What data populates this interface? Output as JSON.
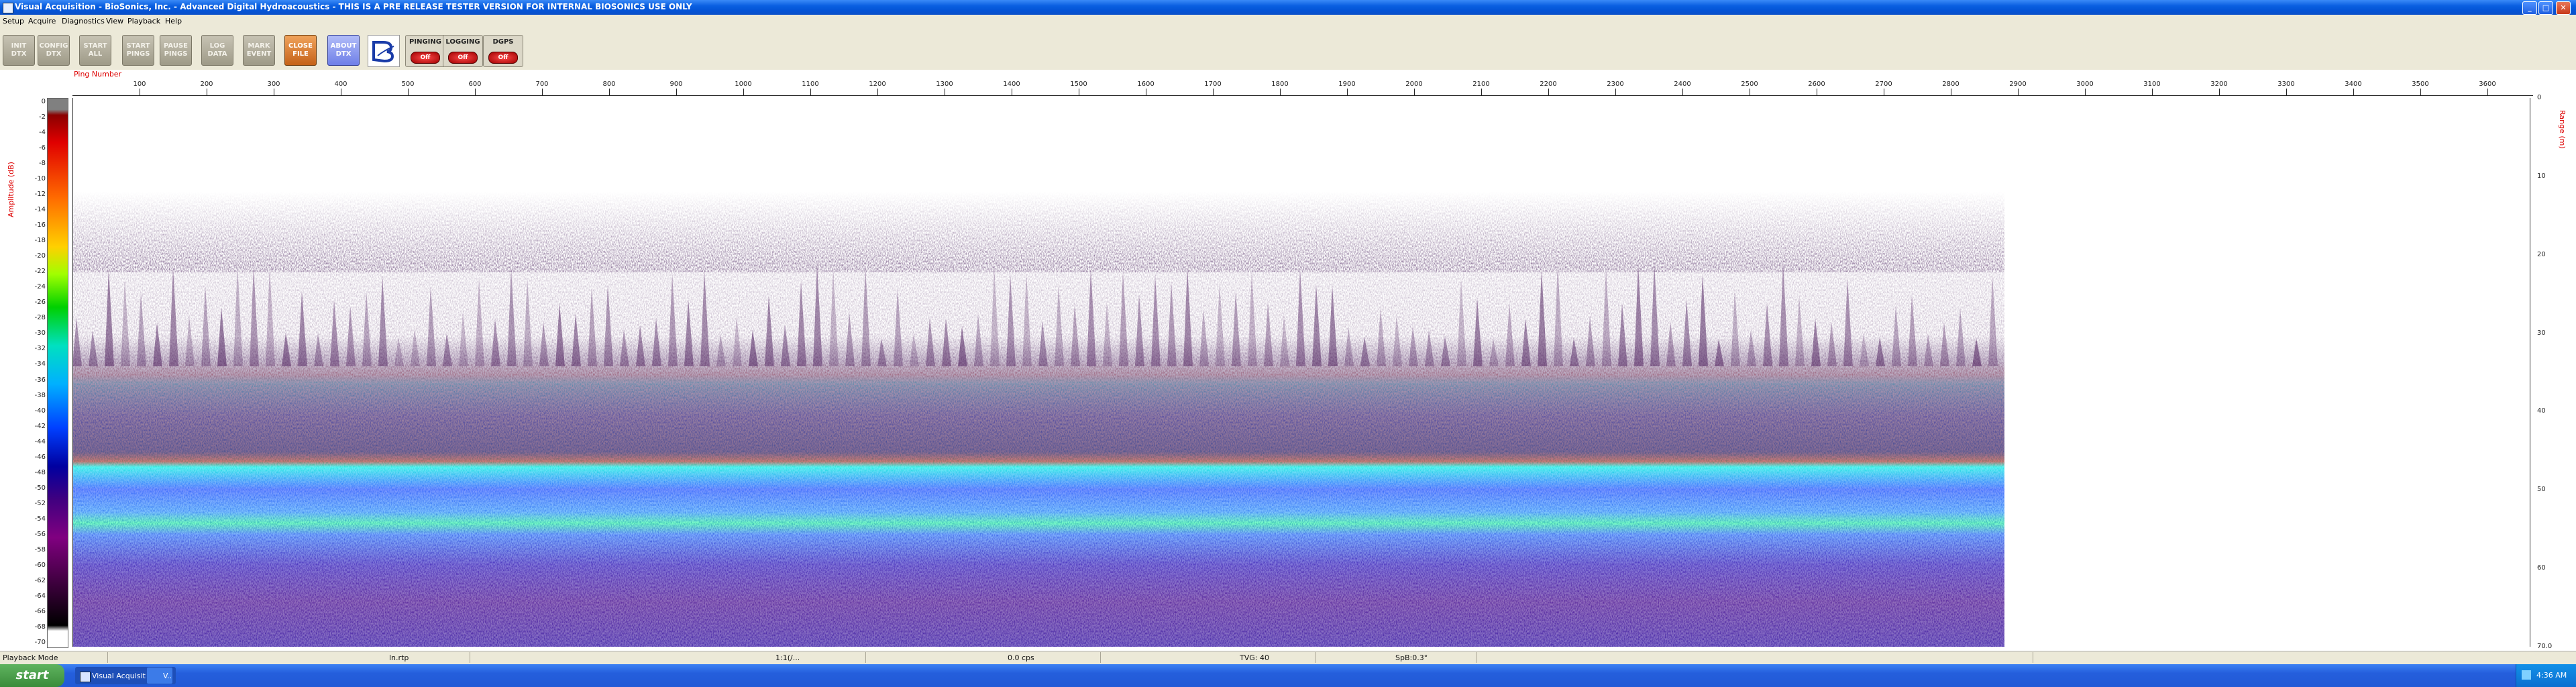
{
  "window": {
    "title": "Visual Acquisition  -  BioSonics, Inc.  -  Advanced Digital Hydroacoustics  -  THIS IS A PRE RELEASE TESTER VERSION FOR INTERNAL BIOSONICS USE ONLY",
    "min": "_",
    "max": "□",
    "close": "✕"
  },
  "menu": [
    "Setup",
    "Acquire",
    "Diagnostics",
    "View",
    "Playback",
    "Help"
  ],
  "toolbar": {
    "buttons": [
      {
        "line1": "INIT",
        "line2": "DTX"
      },
      {
        "line1": "CONFIG",
        "line2": "DTX"
      },
      {
        "line1": "START",
        "line2": "ALL"
      },
      {
        "line1": "START",
        "line2": "PINGS"
      },
      {
        "line1": "PAUSE",
        "line2": "PINGS"
      },
      {
        "line1": "LOG",
        "line2": "DATA"
      },
      {
        "line1": "MARK",
        "line2": "EVENT"
      },
      {
        "line1": "CLOSE",
        "line2": "FILE"
      },
      {
        "line1": "ABOUT",
        "line2": "DTX"
      }
    ],
    "indicators": [
      {
        "label": "PINGING",
        "state": "Off"
      },
      {
        "label": "LOGGING",
        "state": "Off"
      },
      {
        "label": "DGPS",
        "state": "Off"
      }
    ]
  },
  "plot": {
    "x_axis_label": "Ping Number",
    "y_left_label": "Amplitude (dB)",
    "y_right_label": "Range (m)",
    "x_ticks": [
      "100",
      "200",
      "300",
      "400",
      "500",
      "600",
      "700",
      "800",
      "900",
      "1000",
      "1100",
      "1200",
      "1300",
      "1400",
      "1500",
      "1600",
      "1700",
      "1800",
      "1900",
      "2000",
      "2100",
      "2200",
      "2300",
      "2400",
      "2500",
      "2600",
      "2700",
      "2800",
      "2900",
      "3000",
      "3100",
      "3200",
      "3300",
      "3400",
      "3500",
      "3600"
    ],
    "amp_ticks": [
      "0",
      "-2",
      "-4",
      "-6",
      "-8",
      "-10",
      "-12",
      "-14",
      "-16",
      "-18",
      "-20",
      "-22",
      "-24",
      "-26",
      "-28",
      "-30",
      "-32",
      "-34",
      "-36",
      "-38",
      "-40",
      "-42",
      "-44",
      "-46",
      "-48",
      "-50",
      "-52",
      "-54",
      "-56",
      "-58",
      "-60",
      "-62",
      "-64",
      "-66",
      "-68",
      "-70"
    ],
    "range_ticks": [
      "0",
      "10",
      "20",
      "30",
      "40",
      "50",
      "60",
      "70.0"
    ],
    "colors": {
      "surface_noise": "#3d0a4a",
      "bottom_echo": "#00ffd0",
      "deep_layer": "#2a2aff"
    }
  },
  "status": {
    "mode": "Playback Mode",
    "file": "ln.rtp",
    "time": "1:1(/...",
    "gain": "0.0 cps",
    "tvg": "TVG: 40",
    "spb": "SpB:0.3°"
  },
  "taskbar": {
    "start": "start",
    "tasks": [
      "Visual Acquisition",
      "V..."
    ],
    "clock": "4:36 AM"
  }
}
